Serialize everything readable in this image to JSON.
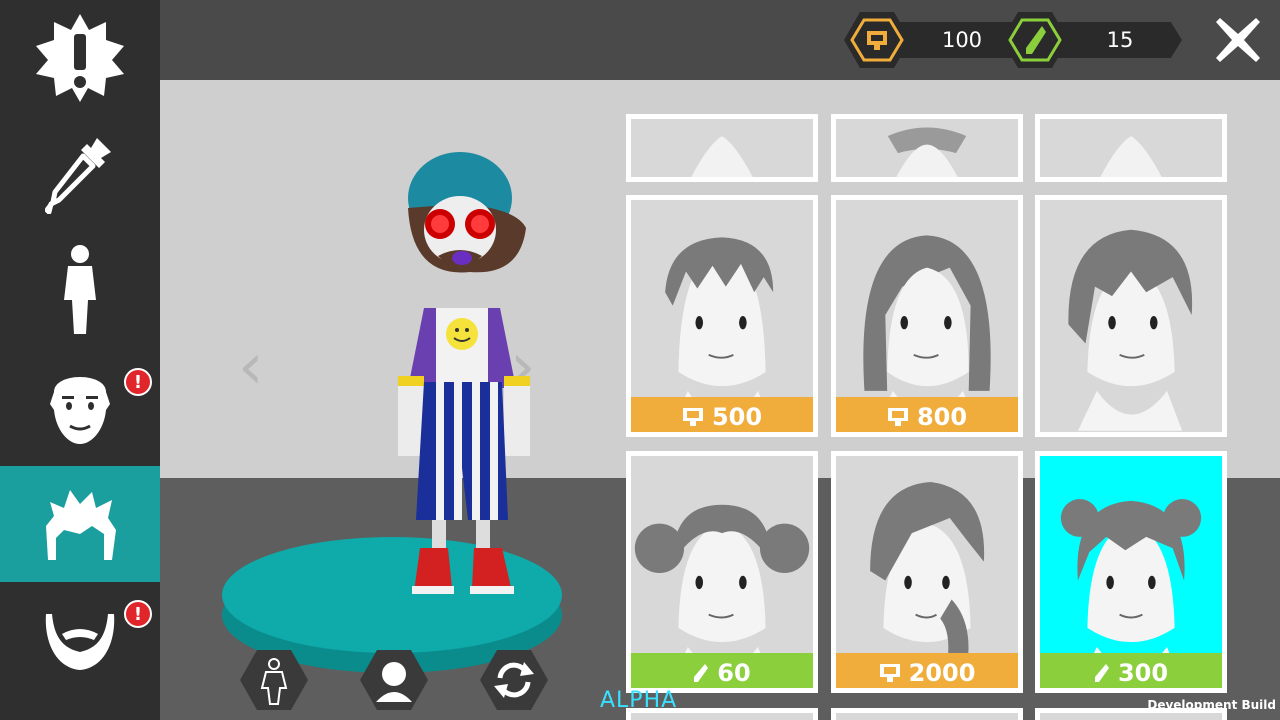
{
  "colors": {
    "sidebar_bg": "#2f2f2f",
    "active_tab": "#1a9e9e",
    "coin_price": "#f0ad3c",
    "gem_price": "#8ccf3c",
    "selected_card": "#00ffff",
    "alert": "#e0262b"
  },
  "sidebar": {
    "items": [
      {
        "name": "news",
        "icon": "exclamation-badge-icon"
      },
      {
        "name": "color",
        "icon": "eyedropper-icon"
      },
      {
        "name": "body",
        "icon": "person-icon"
      },
      {
        "name": "face",
        "icon": "face-icon",
        "alert": "!"
      },
      {
        "name": "hair",
        "icon": "hair-icon",
        "active": true
      },
      {
        "name": "beard",
        "icon": "beard-icon",
        "alert": "!"
      }
    ]
  },
  "currency": {
    "coins": {
      "value": "100",
      "icon": "coin-icon"
    },
    "gems": {
      "value": "15",
      "icon": "gem-icon"
    }
  },
  "close": {
    "icon": "close-icon"
  },
  "nav": {
    "prev": "‹",
    "next": "›"
  },
  "bottom_buttons": [
    {
      "name": "full-body-view",
      "icon": "body-outline-icon"
    },
    {
      "name": "head-view",
      "icon": "head-icon"
    },
    {
      "name": "rotate",
      "icon": "rotate-icon"
    }
  ],
  "hair_grid": {
    "rows": [
      [
        {
          "price": "500",
          "currency": "coin"
        },
        {
          "price": "800",
          "currency": "coin"
        },
        {
          "price": null
        }
      ],
      [
        {
          "price": "60",
          "currency": "gem"
        },
        {
          "price": "2000",
          "currency": "coin"
        },
        {
          "price": "300",
          "currency": "gem",
          "selected": true
        }
      ]
    ]
  },
  "footer": {
    "alpha": "ALPHA",
    "dev_build": "Development Build"
  }
}
